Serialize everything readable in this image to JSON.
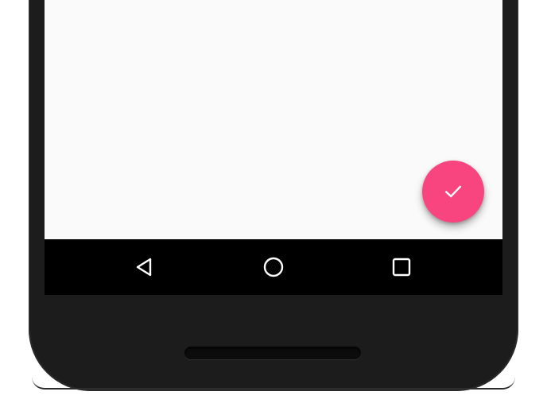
{
  "screen": {
    "background": "#fafafa"
  },
  "fab": {
    "icon": "check-icon",
    "color": "#f8457f",
    "icon_color": "#ffffff"
  },
  "nav_bar": {
    "background": "#000000",
    "buttons": [
      {
        "name": "back",
        "icon": "back-triangle-icon"
      },
      {
        "name": "home",
        "icon": "home-circle-icon"
      },
      {
        "name": "recents",
        "icon": "recents-square-icon"
      }
    ]
  },
  "device": {
    "body_color": "#1c1c1c"
  }
}
